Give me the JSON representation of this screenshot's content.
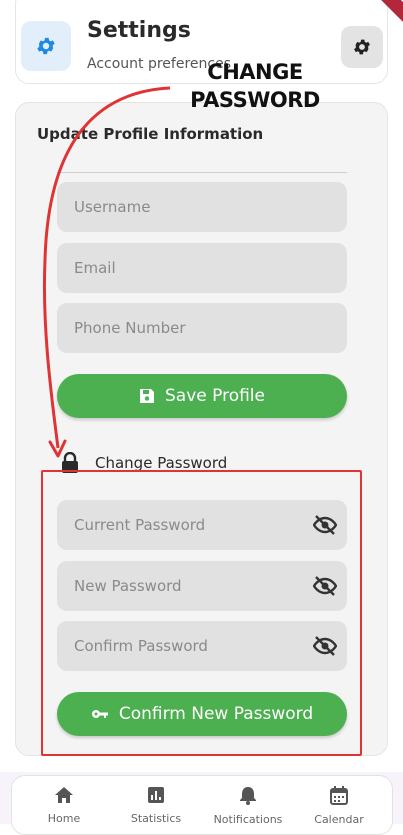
{
  "header": {
    "title": "Settings",
    "subtitle": "Account preferences",
    "settings_icon": "gear-icon",
    "action_icon": "gear-icon"
  },
  "annotation": {
    "label_line1": "CHANGE",
    "label_line2": "PASSWORD",
    "color": "#e03434"
  },
  "profile": {
    "section_title": "Update Profile Information",
    "fields": [
      {
        "placeholder": "Username",
        "value": ""
      },
      {
        "placeholder": "Email",
        "value": ""
      },
      {
        "placeholder": "Phone Number",
        "value": ""
      }
    ],
    "save_label": "Save Profile",
    "save_icon": "floppy-disk-icon"
  },
  "password": {
    "section_label": "Change Password",
    "section_icon": "lock-icon",
    "fields": [
      {
        "placeholder": "Current Password",
        "toggle_icon": "eye-off-icon"
      },
      {
        "placeholder": "New Password",
        "toggle_icon": "eye-off-icon"
      },
      {
        "placeholder": "Confirm Password",
        "toggle_icon": "eye-off-icon"
      }
    ],
    "confirm_label": "Confirm New Password",
    "confirm_icon": "key-icon"
  },
  "nav": {
    "items": [
      {
        "label": "Home",
        "icon": "home-icon"
      },
      {
        "label": "Statistics",
        "icon": "bar-chart-icon"
      },
      {
        "label": "Notifications",
        "icon": "bell-icon"
      },
      {
        "label": "Calendar",
        "icon": "calendar-icon"
      }
    ]
  },
  "colors": {
    "accent_green": "#4caf50",
    "accent_blue": "#1e88e5",
    "highlight_red": "#e03434"
  }
}
